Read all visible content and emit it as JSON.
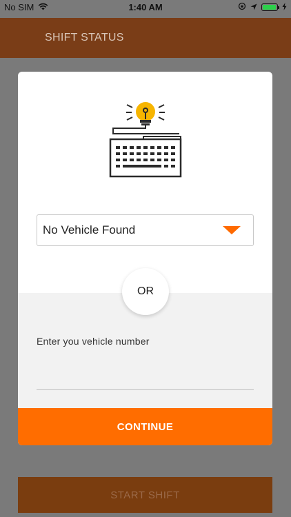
{
  "status_bar": {
    "carrier": "No SIM",
    "time": "1:40 AM",
    "icons": [
      "wifi-icon",
      "orientation-lock-icon",
      "location-arrow-icon",
      "battery-icon",
      "charging-bolt-icon"
    ],
    "battery_level": 0.95
  },
  "header": {
    "title": "SHIFT STATUS",
    "background": "#7a3d17"
  },
  "modal": {
    "illustration_icon": "keyboard-lightbulb-icon",
    "vehicle_select": {
      "selected": "No Vehicle Found",
      "arrow_color": "#ff6a00"
    },
    "divider_text": "OR",
    "vehicle_input": {
      "label": "Enter you vehicle number",
      "value": ""
    },
    "continue_label": "CONTINUE",
    "accent": "#ff6d00"
  },
  "footer": {
    "start_shift_label": "START SHIFT"
  }
}
